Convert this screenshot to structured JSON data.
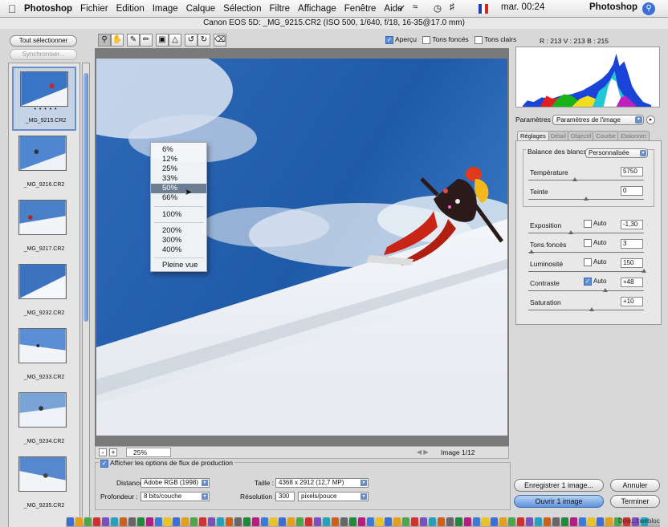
{
  "menubar": {
    "app_name": "Photoshop",
    "menus": [
      "Fichier",
      "Edition",
      "Image",
      "Calque",
      "Sélection",
      "Filtre",
      "Affichage",
      "Fenêtre",
      "Aide"
    ],
    "clock": "mar. 00:24",
    "right_app": "Photoshop",
    "icons": [
      "apple-icon",
      "bluetooth-icon",
      "wifi-icon",
      "sync-icon",
      "volume-icon",
      "french-flag-icon",
      "spotlight-icon"
    ]
  },
  "window": {
    "title": "Canon EOS 5D: _MG_9215.CR2 (ISO 500, 1/640, f/18, 16-35@17.0 mm)"
  },
  "left": {
    "select_all": "Tout sélectionner",
    "synchronize": "Synchroniser...",
    "rating_dots": "• • • • •",
    "thumbnails": [
      {
        "label": "_MG_9215.CR2",
        "selected": true
      },
      {
        "label": "_MG_9216.CR2",
        "selected": false
      },
      {
        "label": "_MG_9217.CR2",
        "selected": false
      },
      {
        "label": "_MG_9232.CR2",
        "selected": false
      },
      {
        "label": "_MG_9233.CR2",
        "selected": false
      },
      {
        "label": "_MG_9234.CR2",
        "selected": false
      },
      {
        "label": "_MG_9235.CR2",
        "selected": false
      }
    ]
  },
  "toolbar": {
    "tools": [
      "zoom-tool-icon",
      "hand-tool-icon",
      "white-balance-tool-icon",
      "color-sampler-icon",
      "crop-tool-icon",
      "straighten-tool-icon",
      "rotate-left-icon",
      "rotate-right-icon",
      "trash-icon"
    ],
    "preview": {
      "label": "Aperçu",
      "checked": true
    },
    "shadows": {
      "label": "Tons foncés",
      "checked": false
    },
    "highlights": {
      "label": "Tons clairs",
      "checked": false
    },
    "rgb_readout": "R : 213   V : 213   B : 215"
  },
  "zoom_menu": {
    "items": [
      "6%",
      "12%",
      "25%",
      "33%",
      "50%",
      "66%",
      "100%",
      "200%",
      "300%",
      "400%",
      "Pleine vue"
    ],
    "highlighted": "50%"
  },
  "zoombar": {
    "minus": "-",
    "plus": "+",
    "zoom_value": "25%",
    "image_counter": "Image 1/12"
  },
  "workflow": {
    "show_options_label": "Afficher les options de flux de production",
    "show_options_checked": true,
    "distance_label": "Distance :",
    "distance_value": "Adobe RGB (1998)",
    "depth_label": "Profondeur :",
    "depth_value": "8 bits/couche",
    "size_label": "Taille :",
    "size_value": "4368 x 2912 (12,7 MP)",
    "resolution_label": "Résolution :",
    "resolution_value": "300",
    "resolution_unit": "pixels/pouce"
  },
  "settings": {
    "params_label": "Paramètres :",
    "params_value": "Paramètres de l'image",
    "tabs": [
      "Réglages",
      "Détail",
      "Objectif",
      "Courbe",
      "Etalonner"
    ],
    "active_tab": "Réglages",
    "wb_label": "Balance des blancs :",
    "wb_value": "Personnalisée",
    "sliders": [
      {
        "label": "Température",
        "value": "5750",
        "auto": null,
        "pos": 0.4
      },
      {
        "label": "Teinte",
        "value": "0",
        "auto": null,
        "pos": 0.5
      },
      {
        "label": "Exposition",
        "value": "-1,30",
        "auto": false,
        "pos": 0.37
      },
      {
        "label": "Tons foncés",
        "value": "3",
        "auto": false,
        "pos": 0.03
      },
      {
        "label": "Luminosité",
        "value": "150",
        "auto": false,
        "pos": 1.0
      },
      {
        "label": "Contraste",
        "value": "+48",
        "auto": true,
        "pos": 0.67
      },
      {
        "label": "Saturation",
        "value": "+10",
        "auto": null,
        "pos": 0.55
      }
    ],
    "auto_label": "Auto"
  },
  "buttons": {
    "save": "Enregistrer 1 image...",
    "cancel": "Annuler",
    "open": "Ouvrir 1 image",
    "done": "Terminer"
  },
  "dock": {
    "label": "Dow...t.webloc"
  }
}
